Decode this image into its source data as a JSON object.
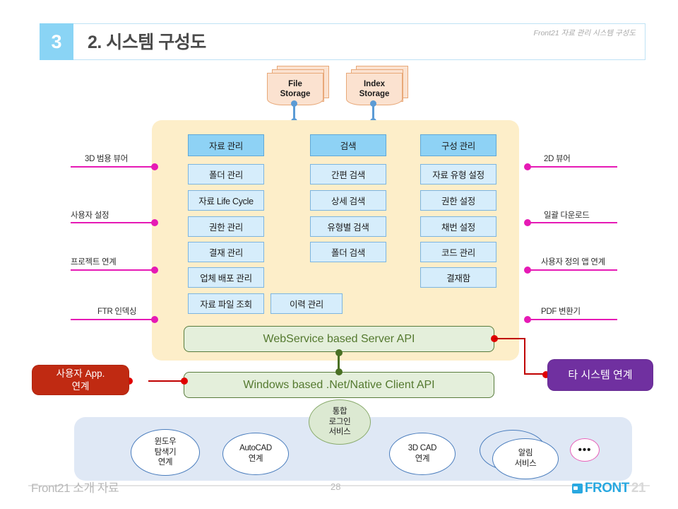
{
  "header": {
    "badge": "3",
    "title": "2. 시스템 구성도",
    "subtitle": "Front21 자료 관리 시스템 구성도"
  },
  "storages": [
    {
      "label": "File Storage",
      "line1": "File",
      "line2": "Storage"
    },
    {
      "label": "Index Storage",
      "line1": "Index",
      "line2": "Storage"
    }
  ],
  "columns": {
    "data_management": {
      "header": "자료 관리",
      "items": [
        "폴더 관리",
        "자료 Life Cycle",
        "권한 관리",
        "결재 관리",
        "업체 배포 관리",
        "자료 파일 조회"
      ]
    },
    "search": {
      "header": "검색",
      "items": [
        "간편 검색",
        "상세 검색",
        "유형별 검색",
        "폴더 검색"
      ]
    },
    "configuration": {
      "header": "구성 관리",
      "items": [
        "자료 유형 설정",
        "권한 설정",
        "채번 설정",
        "코드 관리",
        "결재함"
      ]
    },
    "extra": {
      "history": "이력 관리"
    }
  },
  "apis": {
    "server": "WebService based Server API",
    "client": "Windows based .Net/Native Client API"
  },
  "left_connectors": [
    "3D 범용 뷰어",
    "사용자 설정",
    "프로젝트 연계",
    "FTR 인덱싱"
  ],
  "right_connectors": [
    "2D 뷰어",
    "일괄 다운로드",
    "사용자 정의 앱 연계",
    "PDF 변환기"
  ],
  "callouts": {
    "user_app": {
      "line1": "사용자 App.",
      "line2": "연계"
    },
    "other_system": {
      "label": "타 시스템 연계"
    }
  },
  "services": [
    {
      "name": "windows-explorer",
      "lines": [
        "윈도우",
        "탐색기",
        "연계"
      ]
    },
    {
      "name": "autocad",
      "lines": [
        "AutoCAD",
        "연계"
      ]
    },
    {
      "name": "integrated-login",
      "lines": [
        "통합",
        "로그인",
        "서비스"
      ]
    },
    {
      "name": "3d-cad",
      "lines": [
        "3D CAD",
        "연계"
      ]
    },
    {
      "name": "notification",
      "lines": [
        "알림",
        "서비스"
      ]
    },
    {
      "name": "more",
      "lines": [
        "•••"
      ]
    }
  ],
  "footer": {
    "text": "Front21 소개 자료",
    "page": "28",
    "logo_front": "FRONT",
    "logo_21": "21"
  },
  "colors": {
    "badge": "#8ad4f5",
    "panel": "#fdeec9",
    "module": "#d6edfb",
    "module_header": "#8ed2f5",
    "api": "#e4efdb",
    "api_text": "#54792f",
    "connector_magenta": "#e61ab5",
    "connector_red": "#c00000",
    "callout_red": "#c02a12",
    "callout_purple": "#7030a0",
    "bottom_panel": "#dfe8f5",
    "storage": "#fbe2d0"
  }
}
